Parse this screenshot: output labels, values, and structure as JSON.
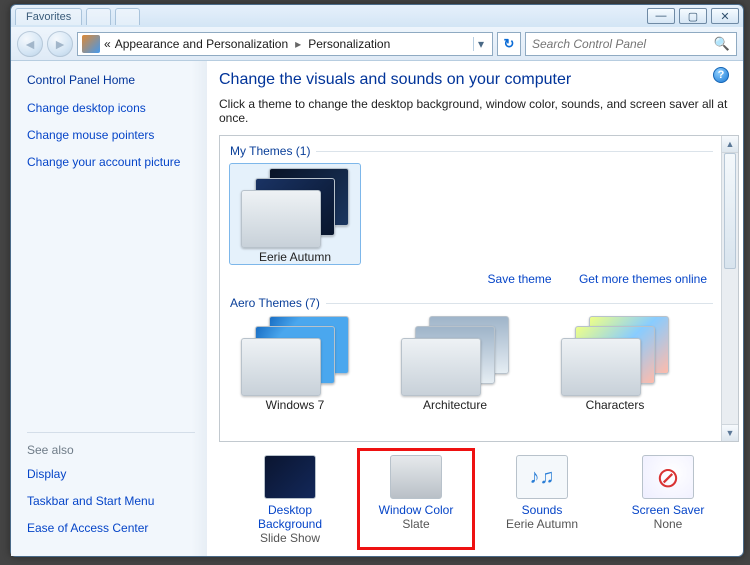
{
  "window": {
    "tabs": [
      "Favorites",
      "",
      ""
    ],
    "buttons": {
      "min": "—",
      "max": "▢",
      "close": "✕"
    }
  },
  "addressbar": {
    "prefix": "«",
    "path1": "Appearance and Personalization",
    "path2": "Personalization",
    "sep": "▸",
    "refresh": "↻",
    "search_placeholder": "Search Control Panel"
  },
  "sidebar": {
    "home": "Control Panel Home",
    "links": [
      "Change desktop icons",
      "Change mouse pointers",
      "Change your account picture"
    ],
    "seealso_hdr": "See also",
    "seealso": [
      "Display",
      "Taskbar and Start Menu",
      "Ease of Access Center"
    ]
  },
  "main": {
    "heading": "Change the visuals and sounds on your computer",
    "sub": "Click a theme to change the desktop background, window color, sounds, and screen saver all at once.",
    "my_label": "My Themes (1)",
    "my_theme": "Eerie Autumn",
    "save_link": "Save theme",
    "more_link": "Get more themes online",
    "aero_label": "Aero Themes (7)",
    "aero": [
      "Windows 7",
      "Architecture",
      "Characters"
    ]
  },
  "bottom": {
    "items": [
      {
        "label": "Desktop Background",
        "value": "Slide Show"
      },
      {
        "label": "Window Color",
        "value": "Slate"
      },
      {
        "label": "Sounds",
        "value": "Eerie Autumn"
      },
      {
        "label": "Screen Saver",
        "value": "None"
      }
    ]
  }
}
